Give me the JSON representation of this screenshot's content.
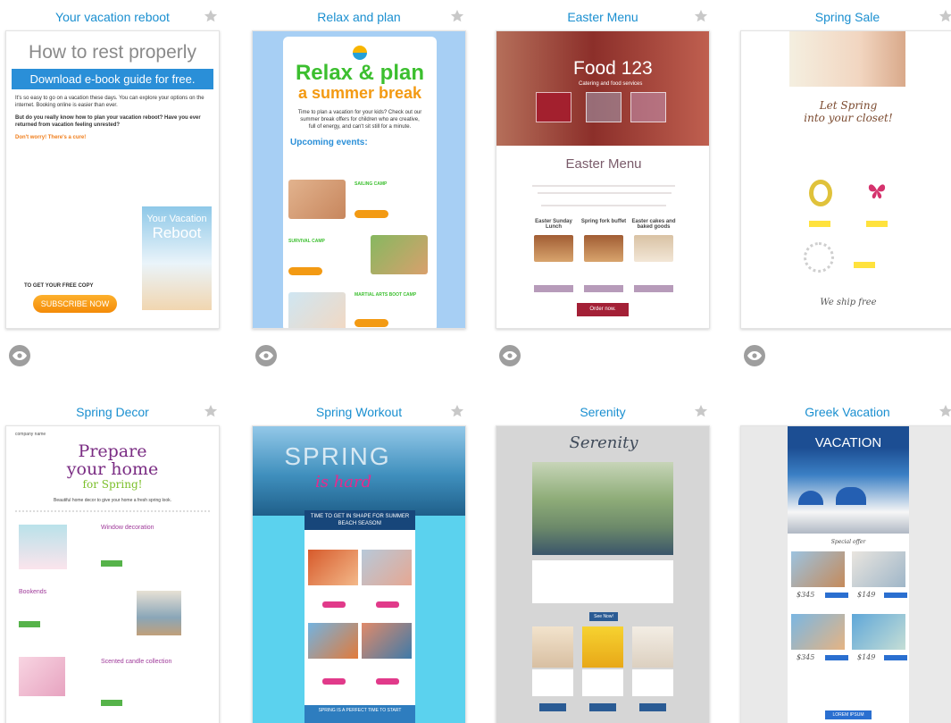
{
  "templates": [
    {
      "title": "Your vacation reboot",
      "content": {
        "headline": "How to rest properly",
        "banner": "Download e-book guide for free.",
        "para1": "It's so easy to go on a vacation these days. You can explore your options on the internet. Booking online is easier than ever.",
        "para2": "But do you really know how to plan your vacation reboot? Have you ever returned from vacation feeling unrested?",
        "cure": "Don't worry! There's a cure!",
        "book_line1": "Your Vacation",
        "book_line2": "Reboot",
        "cta": "TO GET YOUR FREE COPY",
        "button": "SUBSCRIBE NOW"
      }
    },
    {
      "title": "Relax and plan",
      "content": {
        "headline1": "Relax & plan",
        "headline2": "a summer break",
        "intro": "Time to plan a vacation for your kids? Check out our summer break offers for children who are creative, full of energy, and can't sit still for a minute.",
        "upcoming": "Upcoming events:",
        "ev1": "SAILING CAMP",
        "ev2": "SURVIVAL CAMP",
        "ev3": "MARTIAL ARTS BOOT CAMP"
      }
    },
    {
      "title": "Easter Menu",
      "content": {
        "brand": "Food 123",
        "brand_sub": "Catering and food services",
        "heading": "Easter Menu",
        "item1": "Easter Sunday Lunch",
        "item2": "Spring fork buffet",
        "item3": "Easter cakes and baked goods",
        "order": "Order now."
      }
    },
    {
      "title": "Spring Sale",
      "content": {
        "headline1": "Let Spring",
        "headline2": "into your closet!",
        "ship": "We ship free"
      }
    },
    {
      "title": "Spring Decor",
      "content": {
        "company": "company name",
        "headline1": "Prepare",
        "headline2": "your home",
        "headline3": "for Spring!",
        "intro": "Beautiful home decor to give your home a fresh spring look.",
        "sec1": "Window decoration",
        "sec2": "Bookends",
        "sec3": "Scented candle collection"
      }
    },
    {
      "title": "Spring Workout",
      "content": {
        "spring": "SPRING",
        "hard": "is hard",
        "band": "TIME TO GET IN SHAPE FOR SUMMER BEACH SEASON!",
        "foot": "SPRING IS A PERFECT TIME TO START"
      }
    },
    {
      "title": "Serenity",
      "content": {
        "headline": "Serenity",
        "button": "See Now!"
      }
    },
    {
      "title": "Greek Vacation",
      "content": {
        "headline": "VACATION",
        "special": "Special offer",
        "p1": "$345",
        "p2": "$149",
        "p3": "$345",
        "p4": "$149",
        "cta": "LOREM IPSUM"
      }
    }
  ],
  "icons": {
    "favorite": "star-icon",
    "preview": "eye-icon"
  },
  "colors": {
    "title_blue": "#1a8fd0",
    "star_gray": "#c8c8c8",
    "eye_gray": "#9e9e9e"
  }
}
